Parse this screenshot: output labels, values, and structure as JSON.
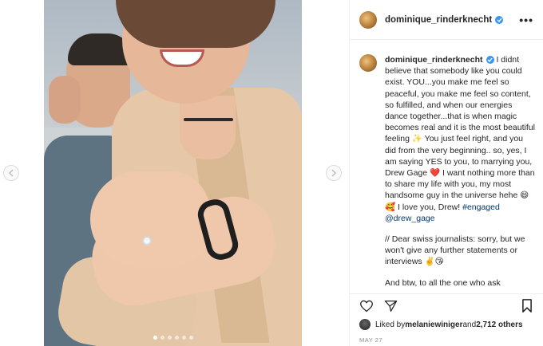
{
  "post": {
    "username": "dominique_rinderknecht",
    "more_label": "•••"
  },
  "caption": {
    "username": "dominique_rinderknecht",
    "text_1": " I didnt believe that somebody like you could exist. YOU...you make me feel so peaceful, you make me feel so content, so fulfilled, and when our energies dance together...that is when magic becomes real and it is the most beautiful feeling ✨ You just feel right, and you did from the very beginning.. so, yes, I am saying YES to you, to marrying you, Drew Gage ❤️ I want nothing more than to share my life with you, my most handsome guy in the universe hehe 😄🥰 I love you, Drew! ",
    "hashtag": "#engaged",
    "mention": "@drew_gage",
    "text_2": "// Dear swiss journalists: sorry, but we won't give any further statements or interviews ✌️😘",
    "text_3": "And btw, to all the one who ask themselves if I'm heterosexual now 👉 I am still pansexual, i just fell in"
  },
  "likes": {
    "prefix": "Liked by ",
    "user": "melaniewiniger",
    "middle": " and ",
    "count": "2,712 others"
  },
  "date": "MAY 27",
  "carousel": {
    "total": 6,
    "active": 1
  },
  "colors": {
    "verified": "#3897f0",
    "link": "#00376b",
    "muted": "#8e8e8e"
  }
}
